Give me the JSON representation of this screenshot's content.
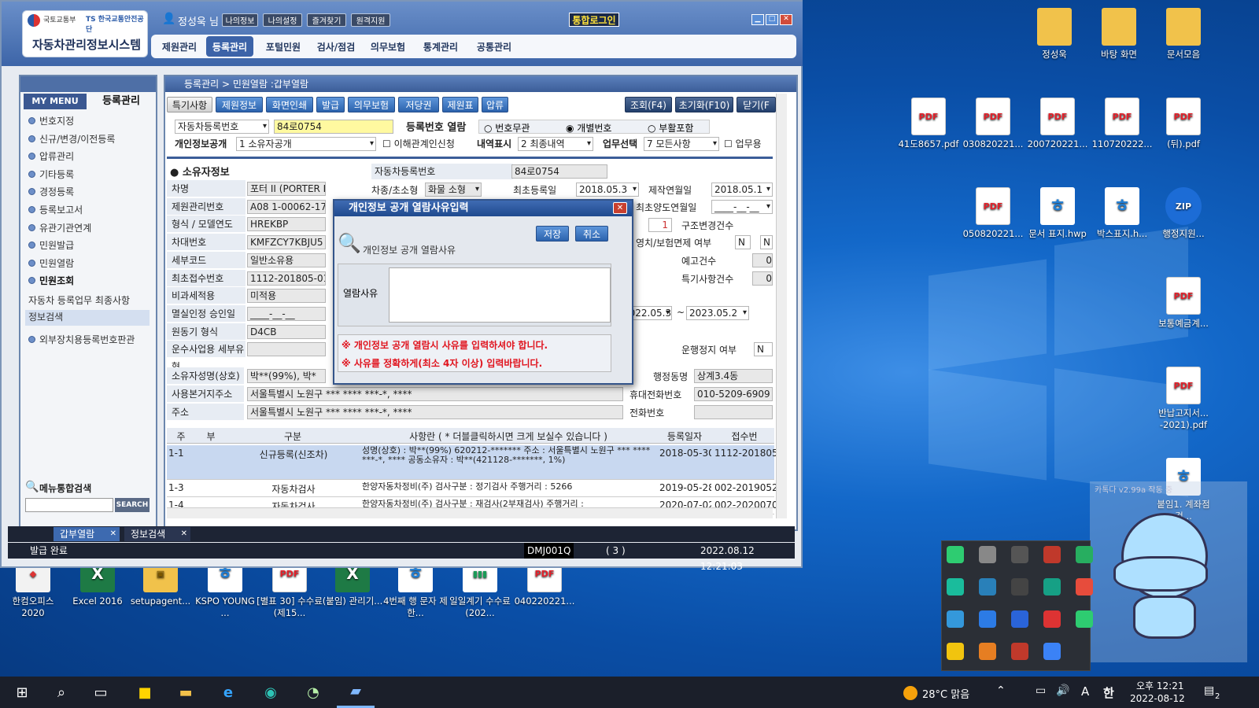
{
  "desktop": {
    "icons": [
      {
        "label": "정성욱",
        "type": "fold",
        "glyph": ""
      },
      {
        "label": "바탕 화면",
        "type": "fold",
        "glyph": ""
      },
      {
        "label": "문서모음",
        "type": "fold",
        "glyph": ""
      },
      {
        "label": "41도8657.pdf",
        "type": "pdf",
        "glyph": "PDF"
      },
      {
        "label": "030820221...",
        "type": "pdf",
        "glyph": "PDF"
      },
      {
        "label": "200720221...",
        "type": "pdf",
        "glyph": "PDF"
      },
      {
        "label": "110720222...",
        "type": "pdf",
        "glyph": "PDF"
      },
      {
        "label": "(뒤).pdf",
        "type": "pdf",
        "glyph": "PDF"
      },
      {
        "label": "050820221...",
        "type": "pdf",
        "glyph": "PDF"
      },
      {
        "label": "문서 표지.hwp",
        "type": "hwp",
        "glyph": "ㅎ"
      },
      {
        "label": "박스표지.h...",
        "type": "hwp",
        "glyph": "ㅎ"
      },
      {
        "label": "행정지원...",
        "type": "zip",
        "glyph": "ZIP"
      },
      {
        "label": "보통예금계...",
        "type": "pdf",
        "glyph": "PDF"
      },
      {
        "label": "반납고지서... -2021).pdf",
        "type": "pdf",
        "glyph": "PDF"
      },
      {
        "label": "붙임1. 계좌점검...",
        "type": "hwp",
        "glyph": "ㅎ"
      },
      {
        "label": "한컴오피스 2020",
        "type": "app",
        "glyph": "◆"
      },
      {
        "label": "Excel 2016",
        "type": "xls",
        "glyph": "X"
      },
      {
        "label": "setupagent...",
        "type": "fold",
        "glyph": "▣"
      },
      {
        "label": "KSPO YOUNG ...",
        "type": "hwp",
        "glyph": "ㅎ"
      },
      {
        "label": "[별표 30] 수수료(제15...",
        "type": "pdf",
        "glyph": "PDF"
      },
      {
        "label": "(붙임) 관리기...",
        "type": "xls",
        "glyph": "X"
      },
      {
        "label": "4번째 행 문자 제한...",
        "type": "hwp",
        "glyph": "ㅎ"
      },
      {
        "label": "일일계기 수수료(202...",
        "type": "bar",
        "glyph": "▮▮▮"
      },
      {
        "label": "040220221...",
        "type": "pdf",
        "glyph": "PDF"
      }
    ],
    "mascot_text": "카톡다 v2.99a 작동 중"
  },
  "app": {
    "org1": "국토교통부",
    "org2": "TS 한국교통안전공단",
    "system_title": "자동차관리정보시스템",
    "user_label": "정성욱 님",
    "top_buttons": [
      "나의정보",
      "나의설정",
      "즐겨찾기",
      "원격지원"
    ],
    "integrated_login": "통합로그인",
    "menu": [
      "제원관리",
      "등록관리",
      "포털민원",
      "검사/점검",
      "의무보험",
      "통계관리",
      "공통관리"
    ],
    "active_menu": "등록관리"
  },
  "left_panel": {
    "my_menu": "MY MENU",
    "section": "등록관리",
    "items": [
      "번호지정",
      "신규/변경/이전등록",
      "압류관리",
      "기타등록",
      "경정등록",
      "등록보고서",
      "유관기관연계",
      "민원발급",
      "민원열람",
      "민원조회"
    ],
    "sub_items": [
      "자동차 등록업무 최종사항",
      "정보검색"
    ],
    "extra_item": "외부장치용등록번호판관",
    "search_label": "메뉴통합검색",
    "search_button": "SEARCH"
  },
  "content": {
    "breadcrumb": "등록관리 > 민원열람 :갑부열람",
    "toolbar": [
      "특기사항",
      "제원정보",
      "화면인쇄",
      "발급",
      "의무보험",
      "저당권",
      "제원표",
      "압류"
    ],
    "toolbar_right": [
      "조회(F4)",
      "초기화(F10)",
      "닫기(F"
    ],
    "search": {
      "type_label": "자동차등록번호",
      "plate": "84로0754",
      "reg_label": "등록번호 열람",
      "radio": [
        "번호무관",
        "개별번호",
        "부활포함"
      ],
      "privacy_label": "개인정보공개",
      "privacy_value": "1 소유자공개",
      "interest_check": "이해관계인신청",
      "history_label": "내역표시",
      "history_value": "2 최종내역",
      "task_label": "업무선택",
      "task_value": "7 모든사항",
      "work_check": "업무용"
    },
    "owner_section": "소유자정보",
    "rows": [
      {
        "label": "차명",
        "value": "포터 II (PORTER II)"
      },
      {
        "label": "제원관리번호",
        "value": "A08 1-00062-17"
      },
      {
        "label": "형식 / 모델연도",
        "value": "HREKBP"
      },
      {
        "label": "차대번호",
        "value": "KMFZCY7KBJU5"
      },
      {
        "label": "세부코드",
        "value": "일반소유용"
      },
      {
        "label": "최초접수번호",
        "value": "1112-201805-01"
      },
      {
        "label": "비과세적용",
        "value": "미적용"
      },
      {
        "label": "멸실인정 승인일",
        "value": "____-__-__"
      },
      {
        "label": "원동기 형식",
        "value": "D4CB"
      },
      {
        "label": "운수사업용 세부유형",
        "value": ""
      }
    ],
    "reg_no_label": "자동차등록번호",
    "reg_no_value": "84로0754",
    "kind_label": "차종/초소형",
    "kind_value": "화물 소형",
    "first_reg_label": "최초등록일",
    "first_reg_value": "2018.05.3",
    "made_label": "제작연월일",
    "made_value": "2018.05.1",
    "transfer_label": "최초양도연월일",
    "transfer_value": "____-__-__",
    "struct_label": "구조변경건수",
    "struct_value": "1",
    "insure_label": "영치/보험면제 여부",
    "insure_value": [
      "N",
      "N"
    ],
    "notice_label": "예고건수",
    "notice_value": "0",
    "special_label": "특기사항건수",
    "special_value": "0",
    "period_from": "2022.05.3",
    "period_to": "2023.05.2",
    "stop_label": "운행정지 여부",
    "stop_value": "N",
    "owner_name_label": "소유자성명(상호)",
    "owner_name_value": "박**(99%), 박*",
    "addr_label": "사용본거지주소",
    "addr_value": "서울특별시 노원구 *** **** ***-*, ****",
    "main_addr_label": "주소",
    "main_addr_value": "서울특별시 노원구 *** **** ***-*, ****",
    "admin_dong_label": "행정동명",
    "admin_dong_value": "상계3.4동",
    "mobile_label": "휴대전화번호",
    "mobile_value": "010-5209-6909",
    "phone_label": "전화번호",
    "phone_value": ""
  },
  "grid": {
    "headers": [
      "주",
      "부",
      "구분",
      "사항란 ( * 더블클릭하시면 크게 보실수 있습니다 )",
      "등록일자",
      "접수번"
    ],
    "rows": [
      {
        "ju": "1-1",
        "bu": "",
        "kind": "신규등록(신조차)",
        "detail": "성명(상호) : 박**(99%)  620212-*******  주소 : 서울특별시 노원구 *** **** ***-*, ****  공동소유자 : 박**(421128-*******, 1%)",
        "date": "2018-05-30",
        "recv": "1112-201805"
      },
      {
        "ju": "1-3",
        "bu": "",
        "kind": "자동차검사",
        "detail": "한양자동차정비(주) 검사구분 : 정기검사 주행거리 : 5266",
        "date": "2019-05-28",
        "recv": "002-2019052"
      },
      {
        "ju": "1-4",
        "bu": "",
        "kind": "자동차검사",
        "detail": "한양자동차정비(주) 검사구분 : 재검사(2부재검사) 주행거리 :",
        "date": "2020-07-02",
        "recv": "002-2020070"
      }
    ]
  },
  "tabs": [
    "갑부열람",
    "정보검색"
  ],
  "status": {
    "message": "발급 완료",
    "screen": "DMJ001Q",
    "count": "( 3 )",
    "datetime": "2022.08.12 12:21:03"
  },
  "dialog": {
    "title": "개인정보 공개 열람사유입력",
    "save": "저장",
    "cancel": "취소",
    "subtitle": "개인정보 공개 열람사유",
    "reason_label": "열람사유",
    "reason_value": "",
    "warn1": "※ 개인정보 공개 열람시 사유를 입력하셔야 합니다.",
    "warn2": "※ 사유를 정확하게(최소 4자 이상) 입력바랍니다."
  },
  "taskbar": {
    "weather": "28°C 맑음",
    "time": "오후 12:21",
    "date": "2022-08-12",
    "ime": "A",
    "ime2": "한",
    "notif": "2"
  }
}
